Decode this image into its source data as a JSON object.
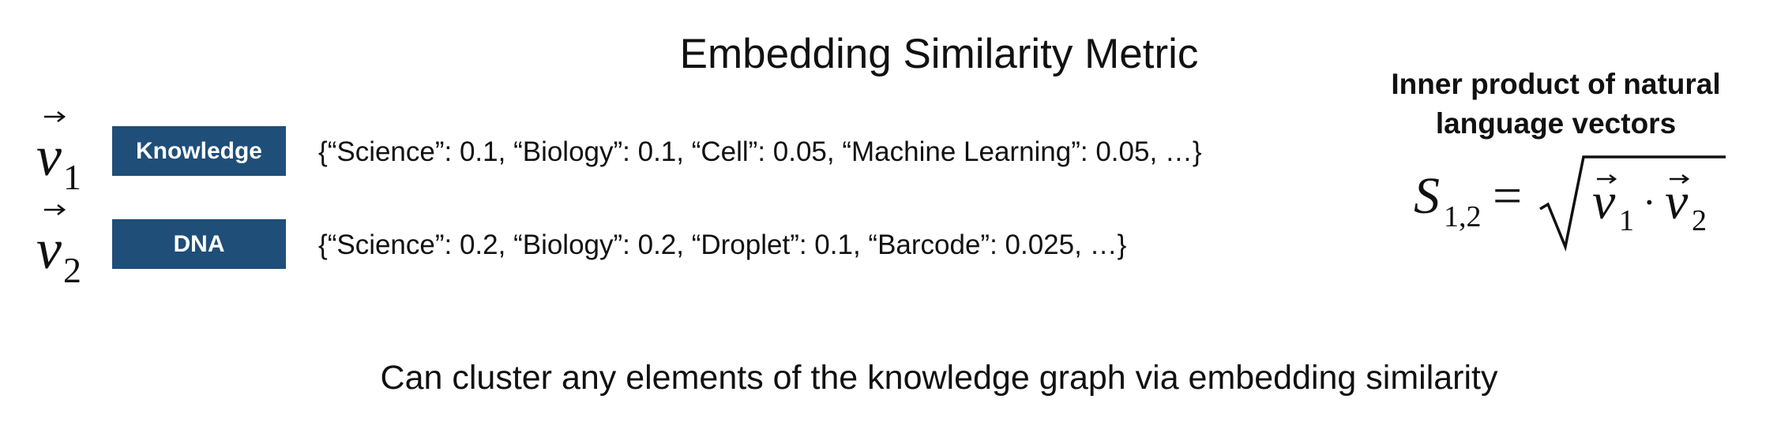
{
  "title": "Embedding Similarity Metric",
  "vectors": [
    {
      "symbol": "v",
      "subscript": "1",
      "concept": "Knowledge",
      "embedding": "{“Science”: 0.1, “Biology”: 0.1, “Cell”: 0.05, “Machine Learning”: 0.05, …}"
    },
    {
      "symbol": "v",
      "subscript": "2",
      "concept": "DNA",
      "embedding": "{“Science”: 0.2, “Biology”: 0.2, “Droplet”: 0.1, “Barcode”: 0.025, …}"
    }
  ],
  "metric": {
    "heading_line1": "Inner product of natural",
    "heading_line2": "language vectors",
    "formula_lhs": "S",
    "formula_lhs_subscript": "1,2",
    "equals": "=",
    "v1_symbol": "v",
    "v1_subscript": "1",
    "dot": "·",
    "v2_symbol": "v",
    "v2_subscript": "2"
  },
  "caption": "Can cluster any elements of the knowledge graph via embedding similarity",
  "colors": {
    "box_fill": "#1f4e79",
    "box_text": "#ffffff",
    "text": "#111111"
  }
}
